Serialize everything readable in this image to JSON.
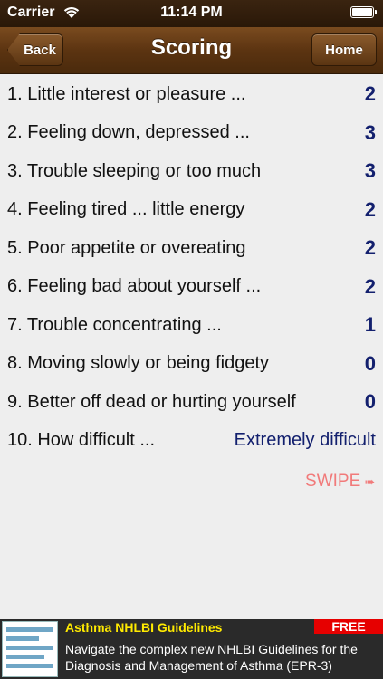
{
  "status_bar": {
    "carrier": "Carrier",
    "time": "11:14 PM",
    "battery_level": 1.0
  },
  "nav": {
    "back_label": "Back",
    "title": "Scoring",
    "home_label": "Home"
  },
  "items": [
    {
      "label": "1. Little interest or pleasure ...",
      "value": "2"
    },
    {
      "label": "2. Feeling down, depressed ...",
      "value": "3"
    },
    {
      "label": "3. Trouble sleeping or too much",
      "value": "3"
    },
    {
      "label": "4. Feeling tired ... little energy",
      "value": "2"
    },
    {
      "label": "5. Poor appetite or overeating",
      "value": "2"
    },
    {
      "label": "6. Feeling bad about yourself ...",
      "value": "2"
    },
    {
      "label": "7. Trouble concentrating ...",
      "value": "1"
    },
    {
      "label": "8. Moving slowly or being fidgety",
      "value": "0"
    },
    {
      "label": "9. Better off dead or hurting yourself",
      "value": "0"
    },
    {
      "label": "10. How difficult ...",
      "value": "Extremely difficult"
    }
  ],
  "swipe_label": "SWIPE",
  "ad": {
    "title": "Asthma NHLBI Guidelines",
    "badge": "FREE",
    "description": "Navigate the complex new NHLBI Guidelines for the Diagnosis and Management of Asthma (EPR-3)"
  },
  "colors": {
    "nav_brown": "#5c3411",
    "score_blue": "#13206e",
    "swipe_red": "#f17a7a",
    "ad_title_yellow": "#ffea00",
    "ad_badge_red": "#e60000"
  }
}
